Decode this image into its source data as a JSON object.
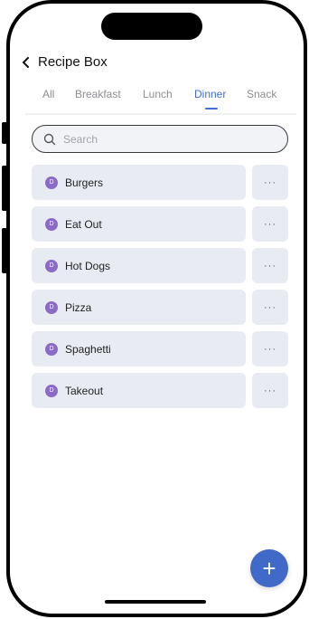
{
  "header": {
    "title": "Recipe Box"
  },
  "tabs": [
    {
      "label": "All"
    },
    {
      "label": "Breakfast"
    },
    {
      "label": "Lunch"
    },
    {
      "label": "Dinner"
    },
    {
      "label": "Snack"
    }
  ],
  "active_tab": "Dinner",
  "search": {
    "placeholder": "Search",
    "value": ""
  },
  "recipes": [
    {
      "badge": "D",
      "name": "Burgers"
    },
    {
      "badge": "D",
      "name": "Eat Out"
    },
    {
      "badge": "D",
      "name": "Hot Dogs"
    },
    {
      "badge": "D",
      "name": "Pizza"
    },
    {
      "badge": "D",
      "name": "Spaghetti"
    },
    {
      "badge": "D",
      "name": "Takeout"
    }
  ],
  "more_label": "···",
  "fab": {
    "label": "+"
  },
  "colors": {
    "accent": "#3f6fd8",
    "badge": "#8a6bc7",
    "fab": "#4169c7",
    "row": "#e8ebf2"
  },
  "icons": {
    "back": "chevron-left-icon",
    "search": "search-icon"
  }
}
